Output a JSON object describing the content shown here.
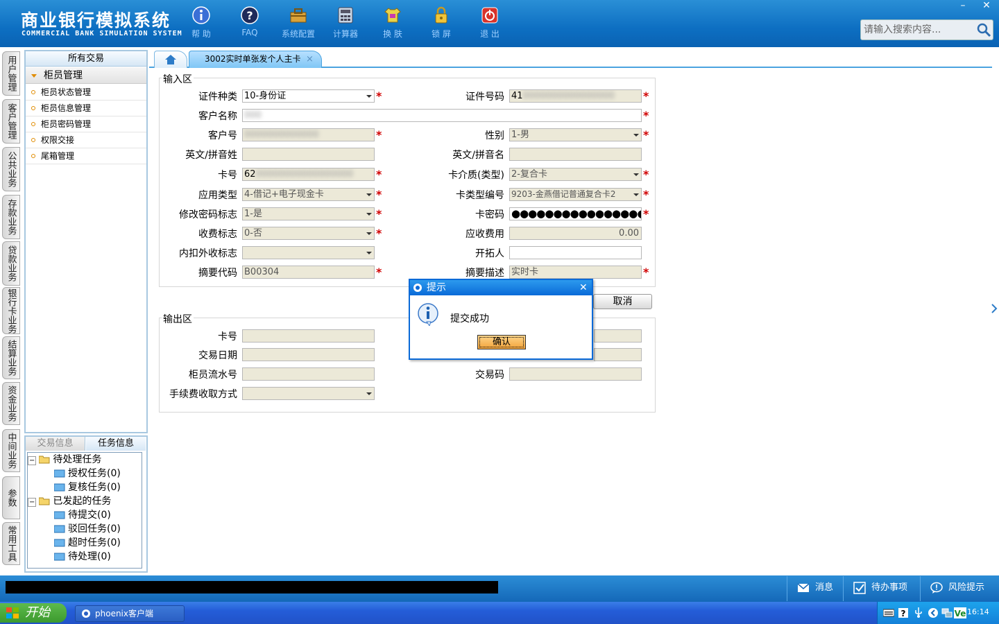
{
  "header": {
    "brand_cn": "商业银行模拟系统",
    "brand_en": "COMMERCIAL BANK SIMULATION SYSTEM",
    "toolbar": [
      {
        "label": "帮 助",
        "icon": "info-icon"
      },
      {
        "label": "FAQ",
        "icon": "help-icon"
      },
      {
        "label": "系统配置",
        "icon": "settings-toolbox-icon"
      },
      {
        "label": "计算器",
        "icon": "calculator-icon"
      },
      {
        "label": "换 肤",
        "icon": "skin-shirt-icon"
      },
      {
        "label": "锁 屏",
        "icon": "lock-icon"
      },
      {
        "label": "退 出",
        "icon": "power-icon"
      }
    ],
    "search_placeholder": "请输入搜索内容...",
    "window_min": "–",
    "window_close": "✕"
  },
  "left_tabs": [
    "用户管理",
    "客户管理",
    "公共业务",
    "存款业务",
    "贷款业务",
    "银行卡业务",
    "结算业务",
    "资金业务",
    "中间业务",
    "参数",
    "常用工具"
  ],
  "nav": {
    "title": "所有交易",
    "group": "柜员管理",
    "items": [
      "柜员状态管理",
      "柜员信息管理",
      "柜员密码管理",
      "权限交接",
      "尾箱管理"
    ]
  },
  "task_panel": {
    "tabs": [
      "交易信息",
      "任务信息"
    ],
    "active_tab": "任务信息",
    "tree": [
      {
        "label": "待处理任务",
        "level": 0
      },
      {
        "label": "授权任务(0)",
        "level": 1
      },
      {
        "label": "复核任务(0)",
        "level": 1
      },
      {
        "label": "已发起的任务",
        "level": 0
      },
      {
        "label": "待提交(0)",
        "level": 1
      },
      {
        "label": "驳回任务(0)",
        "level": 1
      },
      {
        "label": "超时任务(0)",
        "level": 1
      },
      {
        "label": "待处理(0)",
        "level": 1
      }
    ]
  },
  "tabs": {
    "active_label": "3002实时单张发个人主卡",
    "close": "×"
  },
  "input_section": {
    "legend": "输入区",
    "fields": {
      "id_type": {
        "label": "证件种类",
        "value": "10-身份证"
      },
      "id_number": {
        "label": "证件号码",
        "value": "41",
        "hidden": "0000000000000000"
      },
      "customer_name": {
        "label": "客户名称",
        "hidden": "000"
      },
      "customer_no": {
        "label": "客户号",
        "hidden": "0000000000000"
      },
      "gender": {
        "label": "性别",
        "value": "1-男"
      },
      "en_surname": {
        "label": "英文/拼音姓",
        "value": ""
      },
      "en_name": {
        "label": "英文/拼音名",
        "value": ""
      },
      "card_no": {
        "label": "卡号",
        "value": "62",
        "hidden": "00000000000000000"
      },
      "card_medium": {
        "label": "卡介质(类型)",
        "value": "2-复合卡"
      },
      "app_type": {
        "label": "应用类型",
        "value": "4-借记+电子现金卡"
      },
      "card_type_code": {
        "label": "卡类型编号",
        "value": "9203-金燕借记普通复合卡2"
      },
      "pwd_change_flag": {
        "label": "修改密码标志",
        "value": "1-是"
      },
      "card_pwd": {
        "label": "卡密码",
        "value": "●●●●●●●●●●●●●●●●"
      },
      "fee_flag": {
        "label": "收费标志",
        "value": "0-否"
      },
      "fee_amount": {
        "label": "应收费用",
        "value": "0.00"
      },
      "deduct_flag": {
        "label": "内扣外收标志",
        "value": ""
      },
      "developer": {
        "label": "开拓人",
        "value": ""
      },
      "summary_code": {
        "label": "摘要代码",
        "value": "B00304"
      },
      "summary_desc": {
        "label": "摘要描述",
        "value": "实时卡"
      }
    },
    "cancel_label": "取消"
  },
  "output_section": {
    "legend": "输出区",
    "fields": {
      "card_no": {
        "label": "卡号",
        "value": ""
      },
      "trade_date": {
        "label": "交易日期",
        "value": ""
      },
      "teller_serial": {
        "label": "柜员流水号",
        "value": ""
      },
      "trade_code": {
        "label": "交易码",
        "value": ""
      },
      "fee_method": {
        "label": "手续费收取方式",
        "value": ""
      }
    }
  },
  "dialog": {
    "title": "提示",
    "message": "提交成功",
    "ok_label": "确认",
    "close": "✕"
  },
  "statusbar": {
    "message_label": "消息",
    "todo_label": "待办事项",
    "risk_label": "风险提示"
  },
  "taskbar": {
    "start_label": "开始",
    "task_label": "phoenix客户端",
    "time": "16:14"
  },
  "colors": {
    "brand_blue": "#0d6fc2",
    "required_star": "#d00000",
    "dialog_blue": "#0a6ad8"
  }
}
